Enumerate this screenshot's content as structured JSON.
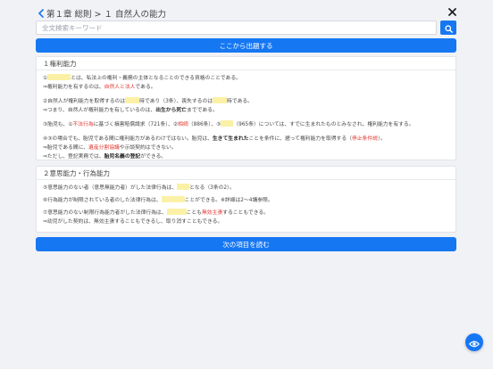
{
  "header": {
    "breadcrumb": "第１章 総則 > １ 自然人の能力"
  },
  "search": {
    "placeholder": "全文検索キーワード"
  },
  "buttons": {
    "start_quiz": "ここから出題する",
    "next_item": "次の項目を読む"
  },
  "sections": [
    {
      "title": "１権利能力",
      "p1_l1_a": "①",
      "p1_l1_b": "とは、私法上の権利・義務の主体となることのできる資格のことである。",
      "p1_l2_a": "⇒権利能力を有するのは、",
      "p1_l2_b": "自然人と法人",
      "p1_l2_c": "である。",
      "p2_l1_a": "②自然人が権利能力を取得するのは",
      "p2_l1_b": "時であり（3条）、喪失するのは",
      "p2_l1_c": "時である。",
      "p2_l2_a": "⇒つまり、自然人が権利能力を有しているのは、",
      "p2_l2_b": "出生から死亡",
      "p2_l2_c": "までである。",
      "p3_l1_a": "③胎児も、①",
      "p3_l1_b": "不法行為",
      "p3_l1_c": "に基づく損害賠償請求（721条）、②",
      "p3_l1_d": "相続",
      "p3_l1_e": "（886条）、③",
      "p3_l1_f": "（965条）については、すでに生まれたものとみなされ、権利能力を有する。",
      "p4_l1_a": "④③の場合でも、胎児である間に権利能力があるわけではない。胎児は、",
      "p4_l1_b": "生きて生まれた",
      "p4_l1_c": "ことを条件に、遡って権利能力を取得する（",
      "p4_l1_d": "停止条件説",
      "p4_l1_e": "）。",
      "p4_l2_a": "⇒胎児である間に、",
      "p4_l2_b": "遺産分割協議",
      "p4_l2_c": "や示談契約はできない。",
      "p4_l3_a": "⇒ただし、登記実務では、",
      "p4_l3_b": "胎児名義の登記",
      "p4_l3_c": "ができる。"
    },
    {
      "title": "２意思能力・行為能力",
      "p1_l1_a": "⑤意思能力のない者（意思無能力者）がした法律行為は、",
      "p1_l1_b": "となる（3条の2）。",
      "p2_l1_a": "⑥行為能力が制限されている者のした法律行為は、",
      "p2_l1_b": "ことができる。※詳細は2〜4講参照。",
      "p3_l1_a": "⑦意思能力のない制限行為能力者がした法律行為は、",
      "p3_l1_b": "ことも",
      "p3_l1_c": "無効主張",
      "p3_l1_d": "することもできる。",
      "p3_l2_a": "⇒幼児がした契約は、無効主張することもできるし、取り消すこともできる。"
    }
  ],
  "icons": {
    "back": "chevron-left-icon",
    "close": "close-icon",
    "search": "search-icon",
    "fab": "eye-icon"
  },
  "colors": {
    "accent": "#1677f3",
    "highlight": "#fbf1a6",
    "emphasis_red": "#e0342c"
  }
}
